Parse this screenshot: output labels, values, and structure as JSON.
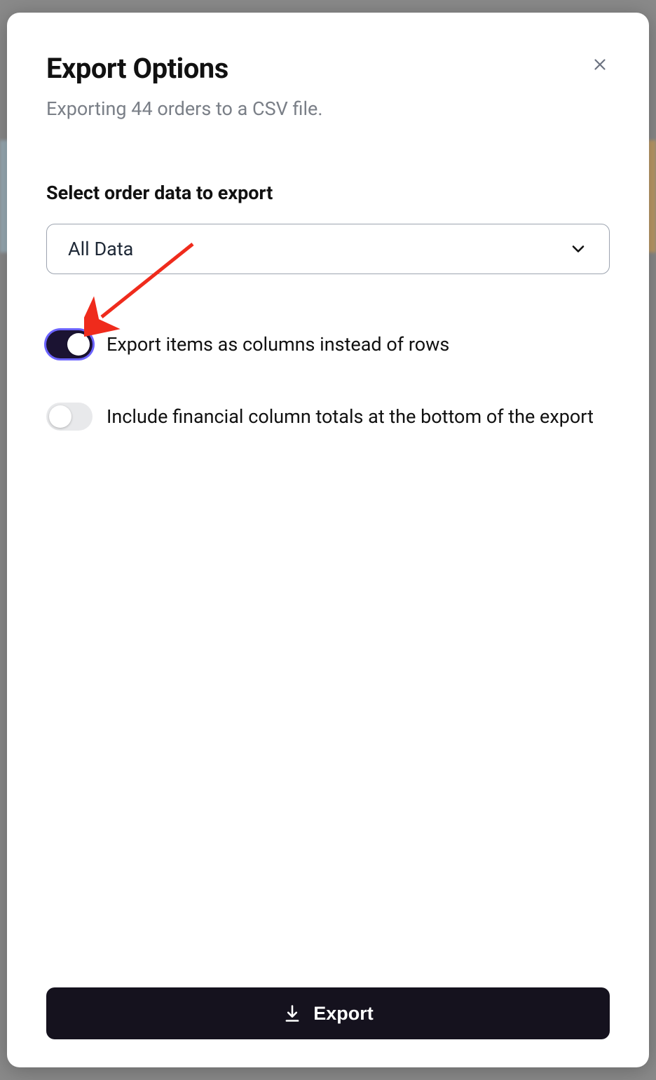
{
  "modal": {
    "title": "Export Options",
    "subtitle": "Exporting 44 orders to a CSV file."
  },
  "form": {
    "select_label": "Select order data to export",
    "select_value": "All Data",
    "toggle_columns": {
      "label": "Export items as columns instead of rows",
      "on": true
    },
    "toggle_totals": {
      "label": "Include financial column totals at the bottom of the export",
      "on": false
    }
  },
  "actions": {
    "export_label": "Export"
  }
}
